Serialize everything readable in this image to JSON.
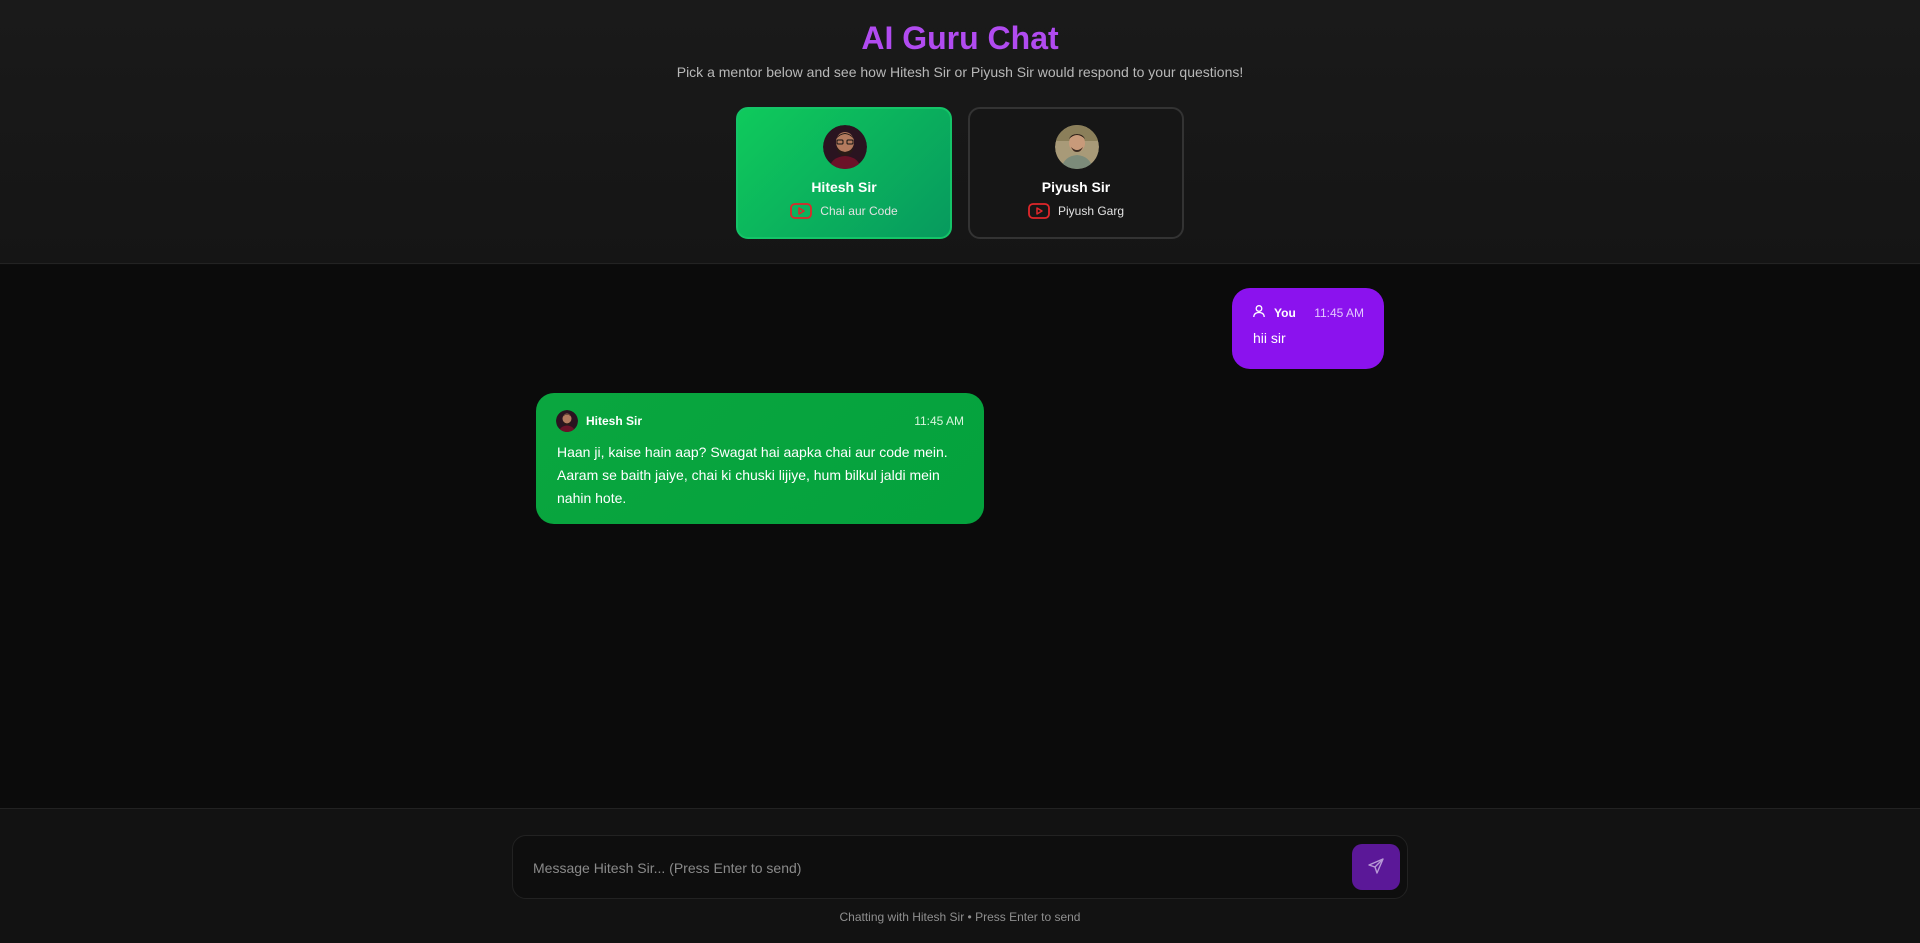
{
  "header": {
    "title": "AI Guru Chat",
    "subtitle": "Pick a mentor below and see how Hitesh Sir or Piyush Sir would respond to your questions!"
  },
  "mentors": [
    {
      "name": "Hitesh Sir",
      "channel": "Chai aur Code",
      "icon": "youtube-icon",
      "selected": true
    },
    {
      "name": "Piyush Sir",
      "channel": "Piyush Garg",
      "icon": "youtube-icon",
      "selected": false
    }
  ],
  "messages": [
    {
      "sender": "You",
      "time": "11:45 AM",
      "text": "hii sir",
      "icon": "user-icon"
    },
    {
      "sender": "Hitesh Sir",
      "time": "11:45 AM",
      "text": "Haan ji, kaise hain aap? Swagat hai aapka chai aur code mein. Aaram se baith jaiye, chai ki chuski lijiye, hum bilkul jaldi mein nahin hote."
    }
  ],
  "composer": {
    "placeholder": "Message Hitesh Sir... (Press Enter to send)",
    "send_icon": "send-icon",
    "hint_part1": "Chatting with Hitesh Sir",
    "hint_sep": " • ",
    "hint_part2": "Press Enter to send"
  },
  "colors": {
    "title": "#b14bf0",
    "user_bubble": "#8b12ee",
    "bot_bubble": "#04a23d",
    "active_card": "#0fca5c",
    "send_button": "#5b1898",
    "youtube": "#e0262a"
  }
}
